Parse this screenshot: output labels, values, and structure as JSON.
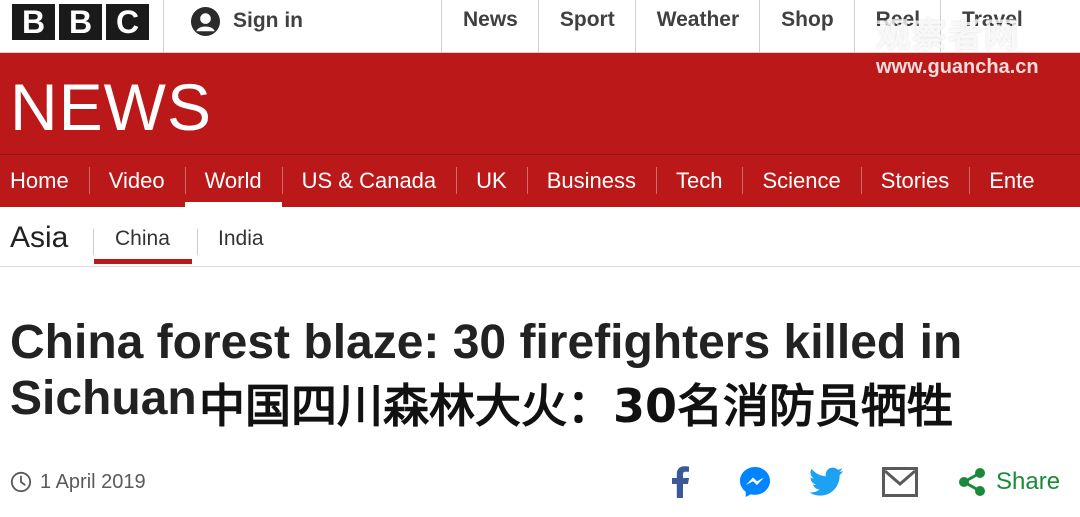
{
  "brand": {
    "letters": [
      "B",
      "B",
      "C"
    ]
  },
  "account": {
    "signin_label": "Sign in"
  },
  "top_nav": [
    {
      "label": "News"
    },
    {
      "label": "Sport"
    },
    {
      "label": "Weather"
    },
    {
      "label": "Shop"
    },
    {
      "label": "Reel"
    },
    {
      "label": "Travel"
    }
  ],
  "watermark": {
    "chinese": "观察者网",
    "url": "www.guancha.cn"
  },
  "header": {
    "title": "NEWS",
    "accent_color": "#bb1919"
  },
  "main_nav": [
    {
      "label": "Home",
      "active": false
    },
    {
      "label": "Video",
      "active": false
    },
    {
      "label": "World",
      "active": true
    },
    {
      "label": "US & Canada",
      "active": false
    },
    {
      "label": "UK",
      "active": false
    },
    {
      "label": "Business",
      "active": false
    },
    {
      "label": "Tech",
      "active": false
    },
    {
      "label": "Science",
      "active": false
    },
    {
      "label": "Stories",
      "active": false
    },
    {
      "label": "Ente",
      "active": false
    }
  ],
  "sub_nav": {
    "section": "Asia",
    "tabs": [
      {
        "label": "China",
        "active": true
      },
      {
        "label": "India",
        "active": false
      }
    ]
  },
  "article": {
    "headline_line1": "China forest blaze: 30 firefighters killed in",
    "headline_line2": "Sichuan",
    "chinese_caption": "中国四川森林大火：30名消防员牺牲",
    "date": "1 April 2019"
  },
  "share": {
    "icons": [
      "facebook-icon",
      "messenger-icon",
      "twitter-icon",
      "email-icon",
      "share-icon"
    ],
    "label": "Share",
    "color": "#1a8a3a"
  }
}
